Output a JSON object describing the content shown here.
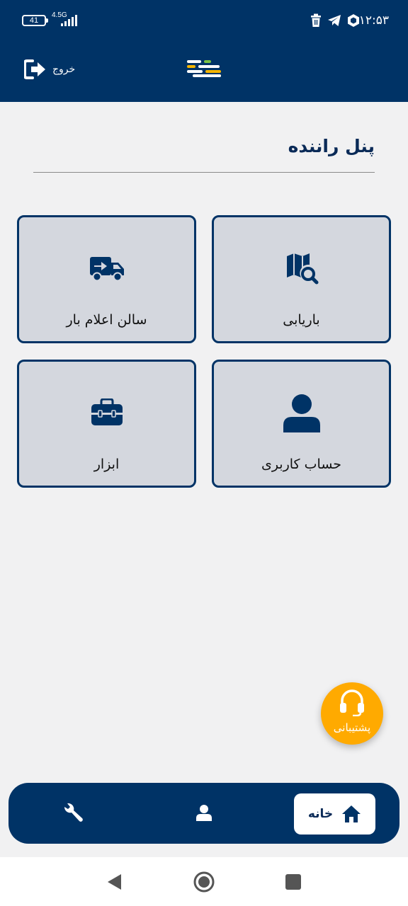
{
  "status_bar": {
    "battery": "41",
    "network": "4.5G",
    "time": "۱۲:۵۳",
    "icons": [
      "trash-icon",
      "telegram-icon",
      "vpn-icon",
      "signal-icon",
      "battery-icon"
    ]
  },
  "header": {
    "logout_label": "خروج",
    "logout_icon": "logout-icon",
    "logo": "app-logo"
  },
  "page": {
    "title": "پنل راننده"
  },
  "cards": [
    {
      "label": "باریابی",
      "icon": "map-search-icon"
    },
    {
      "label": "سالن اعلام بار",
      "icon": "truck-arrow-icon"
    },
    {
      "label": "حساب کاربری",
      "icon": "user-icon"
    },
    {
      "label": "ابزار",
      "icon": "toolbox-icon"
    }
  ],
  "support": {
    "label": "پشتیبانی",
    "icon": "headset-icon"
  },
  "bottom_nav": {
    "home_label": "خانه",
    "items": [
      "home-icon",
      "user-icon",
      "wrench-icon"
    ]
  },
  "colors": {
    "primary": "#003366",
    "card_bg": "#d4d7de",
    "accent": "#ffaa00",
    "background": "#f1f1f2"
  }
}
